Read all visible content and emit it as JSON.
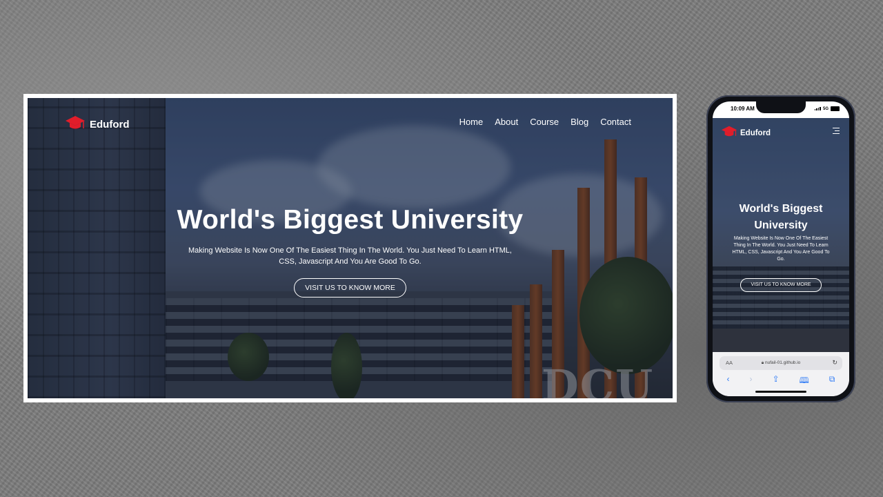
{
  "site": {
    "brand": "Eduford",
    "nav": [
      "Home",
      "About",
      "Course",
      "Blog",
      "Contact"
    ],
    "hero_title": "World's Biggest University",
    "hero_text": "Making Website Is Now One Of The Easiest Thing In The World. You Just Need To Learn HTML, CSS, Javascript And You Are Good To Go.",
    "cta_label": "VISIT US TO KNOW MORE",
    "sign_text": "DCU"
  },
  "phone": {
    "time": "10:09 AM",
    "network": "5G",
    "url": "nufail-01.github.io",
    "aa_label": "AA",
    "hero_title": "World's Biggest University",
    "hero_text": "Making Website Is Now One Of The Easiest Thing In The World. You Just Need To Learn HTML, CSS, Javascript And You Are Good To Go.",
    "cta_label": "VISIT US TO KNOW MORE"
  },
  "icons": {
    "logo": "graduation-cap-icon",
    "menu": "hamburger-icon",
    "reload": "reload-icon",
    "back": "chevron-left-icon",
    "forward": "chevron-right-icon",
    "share": "share-icon",
    "bookmarks": "book-icon",
    "tabs": "tabs-icon"
  },
  "colors": {
    "accent": "#e11d2a",
    "text": "#ffffff"
  }
}
